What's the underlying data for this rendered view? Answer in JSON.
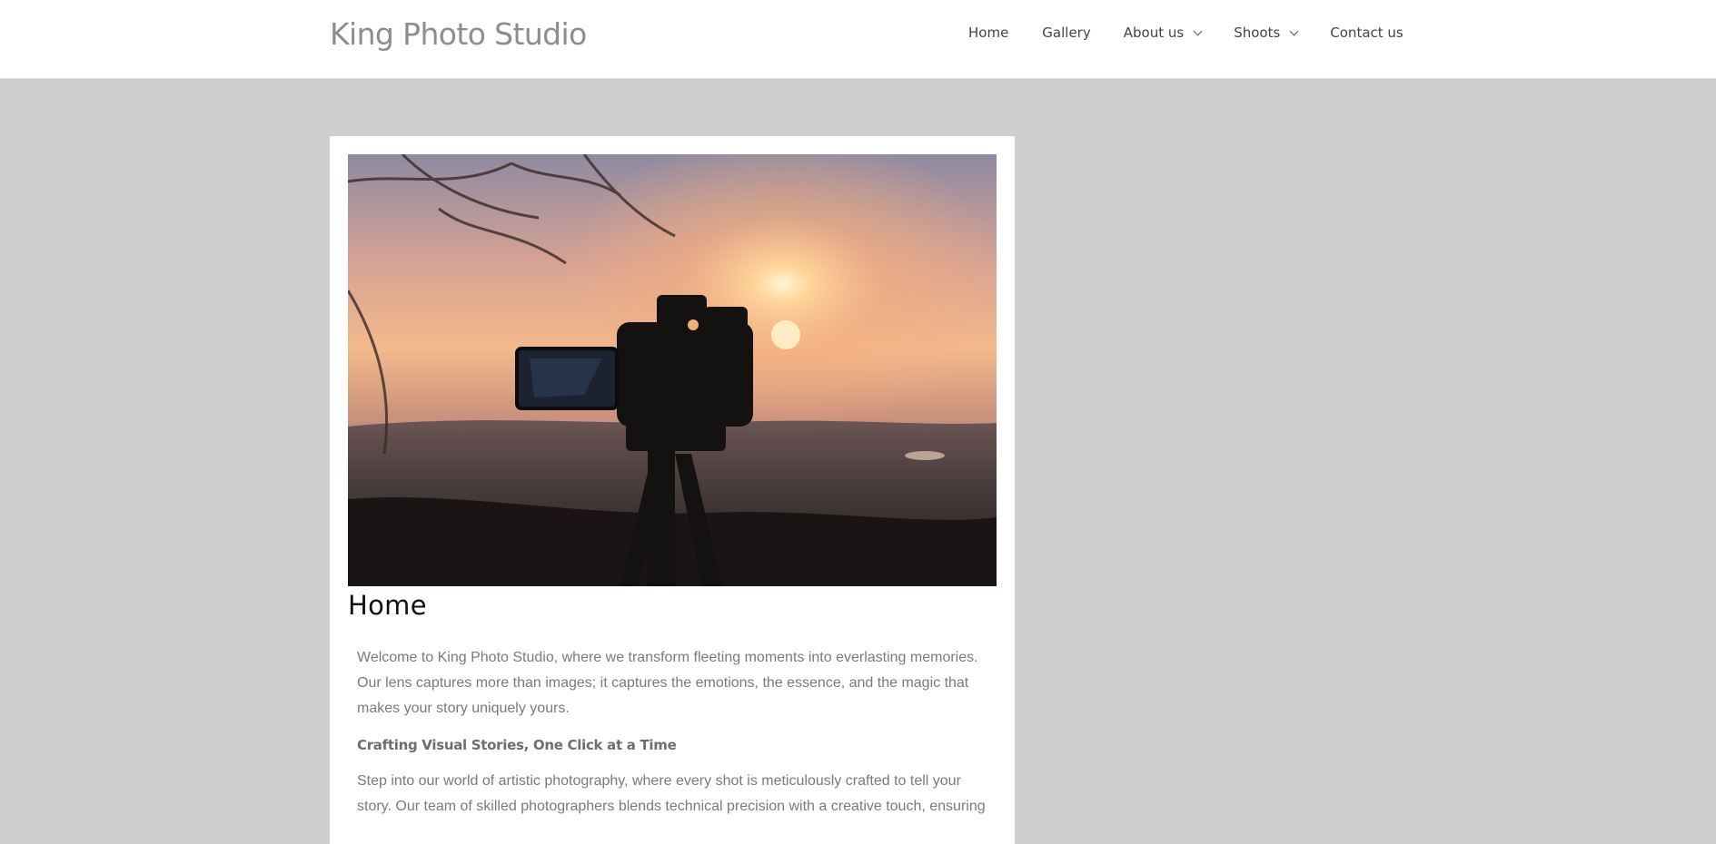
{
  "header": {
    "site_title": "King Photo Studio",
    "nav": [
      {
        "label": "Home",
        "has_dropdown": false
      },
      {
        "label": "Gallery",
        "has_dropdown": false
      },
      {
        "label": "About us",
        "has_dropdown": true
      },
      {
        "label": "Shoots",
        "has_dropdown": true
      },
      {
        "label": "Contact us",
        "has_dropdown": false
      }
    ]
  },
  "main": {
    "hero_icon": "camera-sunset-photo",
    "title": "Home",
    "paragraphs": [
      "Welcome to King Photo Studio, where we transform fleeting moments into everlasting memories. Our lens captures more than images; it captures the emotions, the essence, and the magic that makes your story uniquely yours.",
      "Step into our world of artistic photography, where every shot is meticulously crafted to tell your story. Our team of skilled photographers blends technical precision with a creative touch, ensuring"
    ],
    "subheading": "Crafting Visual Stories, One Click at a Time"
  },
  "colors": {
    "page_background": "#cfcfcf",
    "header_background": "#ffffff",
    "title_color": "#8d8d8d",
    "body_text": "#7a7a7a"
  }
}
